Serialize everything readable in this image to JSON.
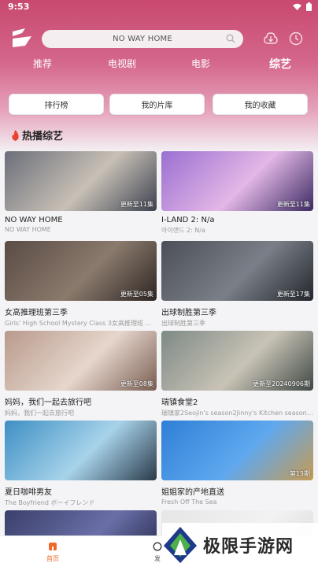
{
  "status": {
    "time": "9:53"
  },
  "search": {
    "text": "NO WAY HOME"
  },
  "tabs": [
    {
      "label": "推荐",
      "active": false
    },
    {
      "label": "电视剧",
      "active": false
    },
    {
      "label": "电影",
      "active": false
    },
    {
      "label": "综艺",
      "active": true
    }
  ],
  "actions": [
    {
      "label": "排行榜"
    },
    {
      "label": "我的片库"
    },
    {
      "label": "我的收藏"
    }
  ],
  "section": {
    "title": "热播综艺"
  },
  "cards": [
    {
      "title": "NO WAY HOME",
      "subtitle": "NO WAY HOME",
      "badge": "更新至11集",
      "colors": [
        "#6b6f7a",
        "#c8c0b6",
        "#3d4250"
      ]
    },
    {
      "title": "I-LAND 2: N/a",
      "subtitle": "아이랜드 2: N/a",
      "badge": "更新至11集",
      "colors": [
        "#9a6fd1",
        "#e3b7e6",
        "#3b2a62"
      ]
    },
    {
      "title": "女高推理班第三季",
      "subtitle": "Girls' High School Mystery Class 3女高推理班 第三...",
      "badge": "更新至05集",
      "colors": [
        "#5a4b45",
        "#8a7a6c",
        "#2e2624"
      ]
    },
    {
      "title": "出球制胜第三季",
      "subtitle": "出球制胜第三季",
      "badge": "更新至17集",
      "colors": [
        "#4b4f57",
        "#7a7f88",
        "#23262c"
      ]
    },
    {
      "title": "妈妈，我们一起去旅行吧",
      "subtitle": "妈妈，我们一起去旅行吧",
      "badge": "更新至08集",
      "colors": [
        "#b89a8c",
        "#e6d6cc",
        "#7a5e52"
      ]
    },
    {
      "title": "瑞镇食堂2",
      "subtitle": "瑞镇家2Seojin's season2Jinny's Kitchen season2 서...",
      "badge": "更新至20240906期",
      "colors": [
        "#7d8a86",
        "#c9c3b6",
        "#3f4945"
      ]
    },
    {
      "title": "夏日咖啡男友",
      "subtitle": "The Boyfriend ボーイフレンド",
      "badge": "",
      "colors": [
        "#3e8fc4",
        "#a7d3ea",
        "#2a3a4a"
      ]
    },
    {
      "title": "姐姐家的产地直送",
      "subtitle": "Fresh Off The Sea",
      "badge": "第13期",
      "colors": [
        "#2f7fd6",
        "#5fa8ef",
        "#c79b52"
      ]
    },
    {
      "title": "",
      "subtitle": "",
      "badge": "",
      "colors": [
        "#3a3f6a",
        "#6a6fa8",
        "#1e2140"
      ]
    },
    {
      "title": "",
      "subtitle": "",
      "badge": "",
      "colors": [
        "#e6e6e6",
        "#f2f2f2",
        "#d8d8d8"
      ]
    }
  ],
  "bottom_nav": {
    "home": "首页",
    "find": "发"
  },
  "watermark": {
    "text": "极限手游网"
  }
}
